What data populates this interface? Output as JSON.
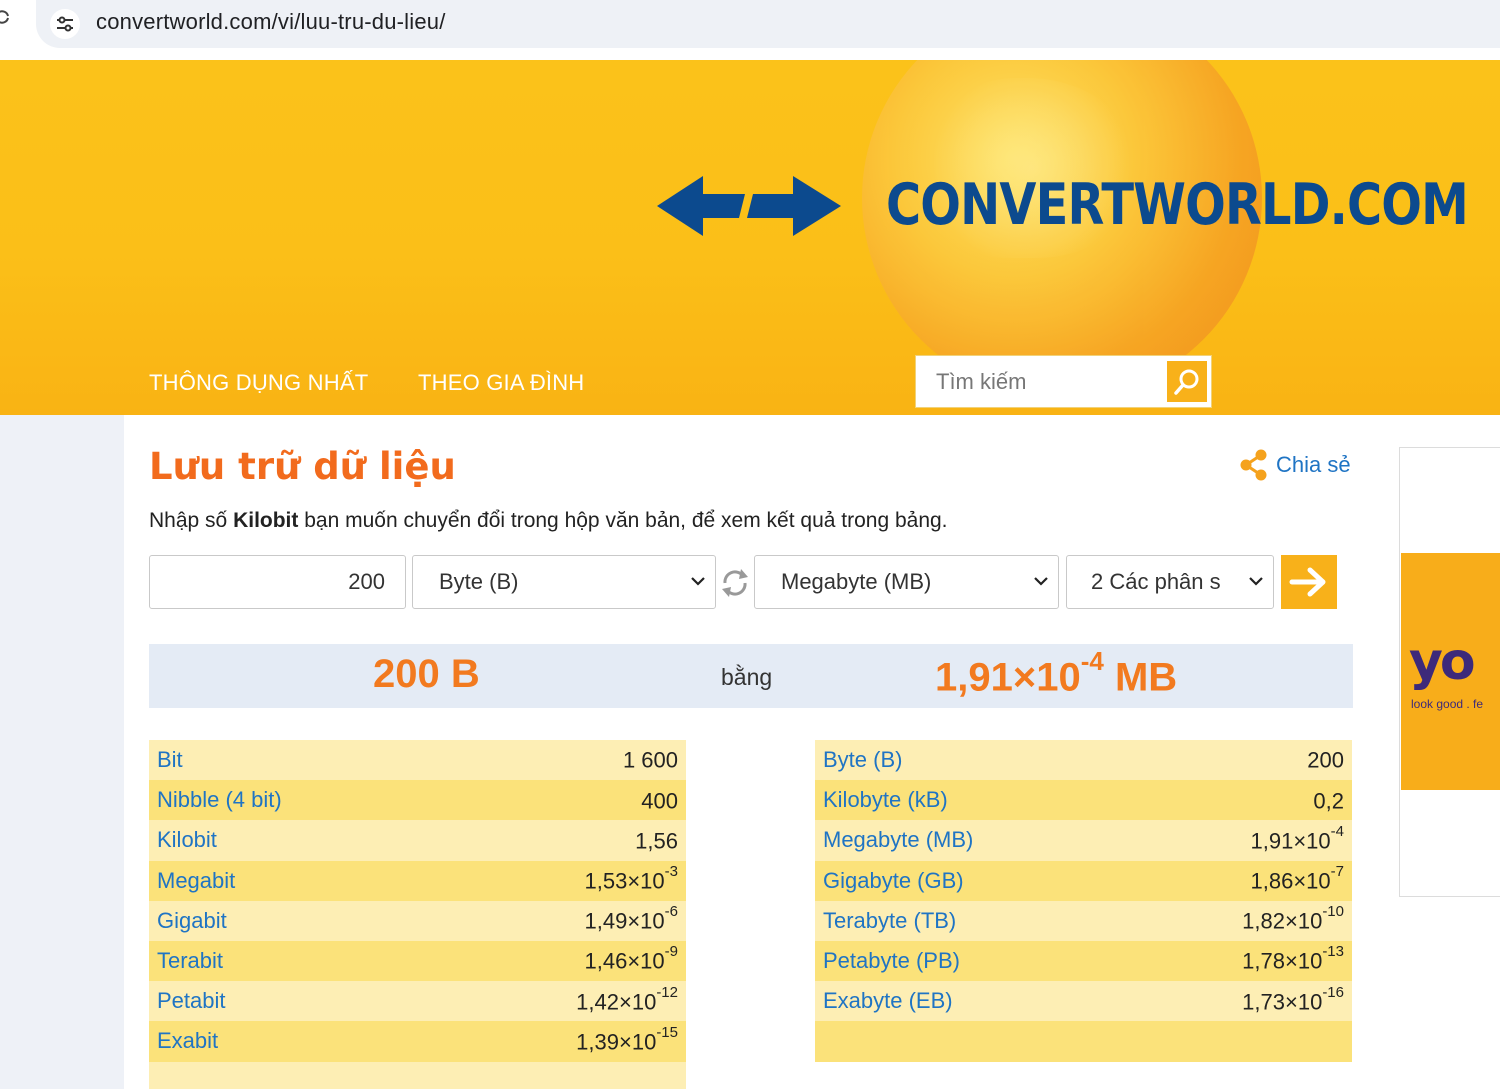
{
  "browser": {
    "url": "convertworld.com/vi/luu-tru-du-lieu/"
  },
  "header": {
    "brand": "CONVERTWORLD.COM",
    "nav": [
      "THÔNG DỤNG NHẤT",
      "THEO GIA ĐÌNH"
    ],
    "search_placeholder": "Tìm kiếm"
  },
  "page": {
    "title": "Lưu trữ dữ liệu",
    "share_label": "Chia sẻ",
    "instruction_before": "Nhập số ",
    "instruction_unit": "Kilobit",
    "instruction_after": " bạn muốn chuyển đổi trong hộp văn bản, để xem kết quả trong bảng."
  },
  "converter": {
    "amount": "200",
    "from_unit": "Byte (B)",
    "to_unit": "Megabyte (MB)",
    "decimals": "2 Các phân s"
  },
  "result": {
    "from_text": "200 B",
    "equals_word": "bằng",
    "to_mantissa": "1,91×10",
    "to_exponent": "-4",
    "to_unit": " MB"
  },
  "table_left": [
    {
      "unit": "Bit",
      "mantissa": "1 600",
      "exp": ""
    },
    {
      "unit": "Nibble (4 bit)",
      "mantissa": "400",
      "exp": ""
    },
    {
      "unit": "Kilobit",
      "mantissa": "1,56",
      "exp": ""
    },
    {
      "unit": "Megabit",
      "mantissa": "1,53×10",
      "exp": "-3"
    },
    {
      "unit": "Gigabit",
      "mantissa": "1,49×10",
      "exp": "-6"
    },
    {
      "unit": "Terabit",
      "mantissa": "1,46×10",
      "exp": "-9"
    },
    {
      "unit": "Petabit",
      "mantissa": "1,42×10",
      "exp": "-12"
    },
    {
      "unit": "Exabit",
      "mantissa": "1,39×10",
      "exp": "-15"
    },
    {
      "unit": "",
      "mantissa": "",
      "exp": ""
    }
  ],
  "table_right": [
    {
      "unit": "Byte (B)",
      "mantissa": "200",
      "exp": ""
    },
    {
      "unit": "Kilobyte (kB)",
      "mantissa": "0,2",
      "exp": ""
    },
    {
      "unit": "Megabyte (MB)",
      "mantissa": "1,91×10",
      "exp": "-4"
    },
    {
      "unit": "Gigabyte (GB)",
      "mantissa": "1,86×10",
      "exp": "-7"
    },
    {
      "unit": "Terabyte (TB)",
      "mantissa": "1,82×10",
      "exp": "-10"
    },
    {
      "unit": "Petabyte (PB)",
      "mantissa": "1,78×10",
      "exp": "-13"
    },
    {
      "unit": "Exabyte (EB)",
      "mantissa": "1,73×10",
      "exp": "-16"
    },
    {
      "unit": "",
      "mantissa": "",
      "exp": ""
    }
  ],
  "ad": {
    "logo": "yo",
    "tagline": "look good . fe"
  },
  "colors": {
    "header_yellow": "#fbc21a",
    "title_orange": "#f26b1d",
    "link_blue": "#1f74c4",
    "brand_blue": "#0c4a8e"
  }
}
